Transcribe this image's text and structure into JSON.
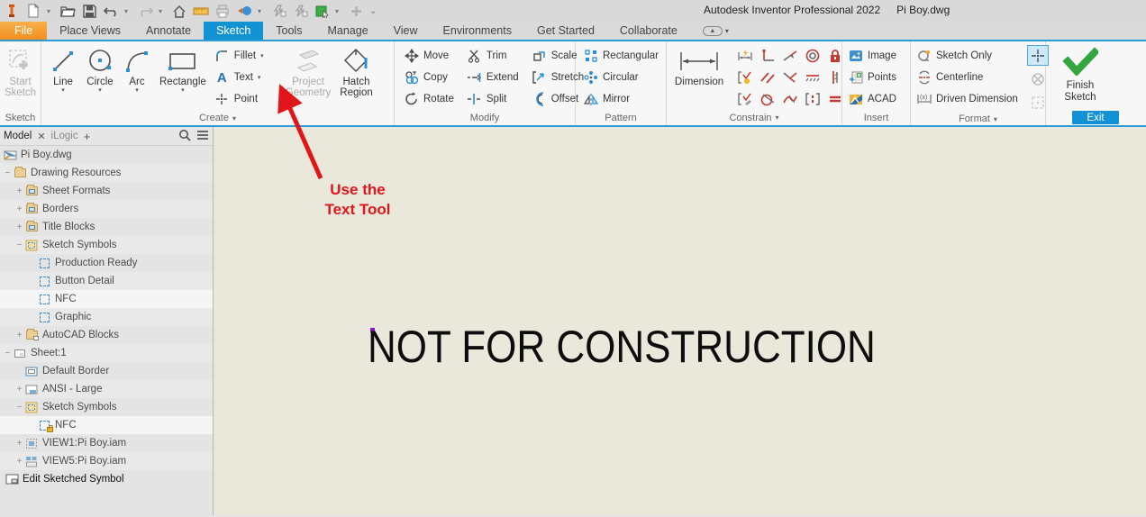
{
  "titlebar": {
    "title": "Autodesk Inventor Professional 2022",
    "document": "Pi Boy.dwg",
    "qat_icons": [
      "inventor-logo",
      "new-file",
      "open-file",
      "save",
      "undo",
      "redo",
      "home",
      "measure",
      "print",
      "return",
      "ilogic-trigger-a",
      "ilogic-trigger-b",
      "appearance-picker",
      "add-command",
      "customize-toolbar"
    ]
  },
  "tabs": {
    "items": [
      {
        "label": "File"
      },
      {
        "label": "Place Views"
      },
      {
        "label": "Annotate"
      },
      {
        "label": "Sketch"
      },
      {
        "label": "Tools"
      },
      {
        "label": "Manage"
      },
      {
        "label": "View"
      },
      {
        "label": "Environments"
      },
      {
        "label": "Get Started"
      },
      {
        "label": "Collaborate"
      }
    ],
    "active": "Sketch"
  },
  "ribbon": {
    "sketch_panel": {
      "button_l1": "Start",
      "button_l2": "Sketch",
      "label": "Sketch"
    },
    "create": {
      "big": [
        "Line",
        "Circle",
        "Arc",
        "Rectangle"
      ],
      "small": [
        "Fillet",
        "Text",
        "Point"
      ],
      "project_geometry_l1": "Project",
      "project_geometry_l2": "Geometry",
      "hatch_region_l1": "Hatch",
      "hatch_region_l2": "Region",
      "label": "Create"
    },
    "modify": {
      "buttons": [
        "Move",
        "Copy",
        "Rotate",
        "Trim",
        "Extend",
        "Split",
        "Scale",
        "Stretch",
        "Offset"
      ],
      "label": "Modify"
    },
    "pattern": {
      "buttons": [
        "Rectangular",
        "Circular",
        "Mirror"
      ],
      "label": "Pattern"
    },
    "constrain": {
      "dimension": "Dimension",
      "label": "Constrain",
      "icons": [
        "auto-dimension",
        "perpendicular",
        "coincident",
        "concentric",
        "fix-lock",
        "show-constraints",
        "parallel",
        "tangent",
        "horizontal",
        "vertical",
        "constraint-settings",
        "tangent-circle",
        "smooth",
        "symmetric",
        "equal"
      ]
    },
    "insert": {
      "buttons": [
        "Image",
        "Points",
        "ACAD"
      ],
      "label": "Insert"
    },
    "format": {
      "buttons": [
        "Sketch Only",
        "Centerline",
        "Driven Dimension"
      ],
      "label": "Format",
      "toggles": [
        "center-point-toggle",
        "construction-toggle",
        "driven-toggle"
      ]
    },
    "exit": {
      "button_l1": "Finish",
      "button_l2": "Sketch",
      "label": "Exit"
    }
  },
  "browser": {
    "tabs": {
      "model": "Model",
      "ilogic": "iLogic"
    },
    "tree": [
      {
        "label": "Pi Boy.dwg"
      },
      {
        "label": "Drawing Resources"
      },
      {
        "label": "Sheet Formats"
      },
      {
        "label": "Borders"
      },
      {
        "label": "Title Blocks"
      },
      {
        "label": "Sketch Symbols"
      },
      {
        "label": "Production Ready"
      },
      {
        "label": "Button Detail"
      },
      {
        "label": "NFC"
      },
      {
        "label": "Graphic"
      },
      {
        "label": "AutoCAD Blocks"
      },
      {
        "label": "Sheet:1"
      },
      {
        "label": "Default Border"
      },
      {
        "label": "ANSI - Large"
      },
      {
        "label": "Sketch Symbols"
      },
      {
        "label": "NFC"
      },
      {
        "label": "VIEW1:Pi Boy.iam"
      },
      {
        "label": "VIEW5:Pi Boy.iam"
      },
      {
        "label": "Edit Sketched Symbol"
      }
    ]
  },
  "canvas": {
    "sketch_text": "NOT FOR CONSTRUCTION",
    "annotation_line1": "Use the",
    "annotation_line2": "Text Tool"
  },
  "colors": {
    "accent_blue": "#1292d2",
    "file_orange": "#f49a28",
    "annotation_red": "#e0161b",
    "canvas_beige": "#e9e8db",
    "finish_green": "#33a640"
  }
}
